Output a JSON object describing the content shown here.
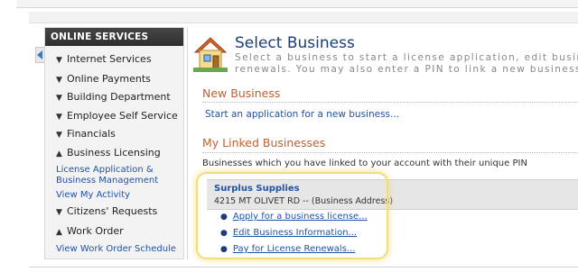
{
  "sidebar": {
    "header": "ONLINE SERVICES",
    "items": [
      {
        "label": "Internet Services",
        "state": "collapsed"
      },
      {
        "label": "Online Payments",
        "state": "collapsed"
      },
      {
        "label": "Building Department",
        "state": "collapsed"
      },
      {
        "label": "Employee Self Service",
        "state": "collapsed"
      },
      {
        "label": "Financials",
        "state": "collapsed"
      },
      {
        "label": "Business Licensing",
        "state": "expanded"
      },
      {
        "label": "Citizens' Requests",
        "state": "collapsed"
      },
      {
        "label": "Work Order",
        "state": "expanded"
      }
    ],
    "business_licensing_links": [
      "License Application & Business Management",
      "View My Activity"
    ],
    "work_order_links": [
      "View Work Order Schedule"
    ]
  },
  "main": {
    "title": "Select Business",
    "description_line1": "Select a business to start a license application, edit busines",
    "description_line2": "renewals. You may also enter a PIN to link a new business to",
    "new_business": {
      "heading": "New Business",
      "link": "Start an application for a new business..."
    },
    "linked": {
      "heading": "My Linked Businesses",
      "description": "Businesses which you have linked to your account with their unique PIN",
      "business": {
        "name": "Surplus Supplies",
        "address": "4215 MT OLIVET RD -- (Business Address)",
        "actions": [
          "Apply for a business license...",
          "Edit Business Information...",
          "Pay for License Renewals..."
        ]
      }
    }
  },
  "icons": {
    "expand_caret": "triangle-down",
    "collapse_caret": "triangle-up",
    "collapse_panel": "triangle-left",
    "page_icon": "house-icon"
  },
  "colors": {
    "link": "#2052a6",
    "section_heading": "#c0602c",
    "title": "#1c3d78",
    "sidebar_header": "#3a3a3a",
    "highlight": "#f2dd7a"
  }
}
